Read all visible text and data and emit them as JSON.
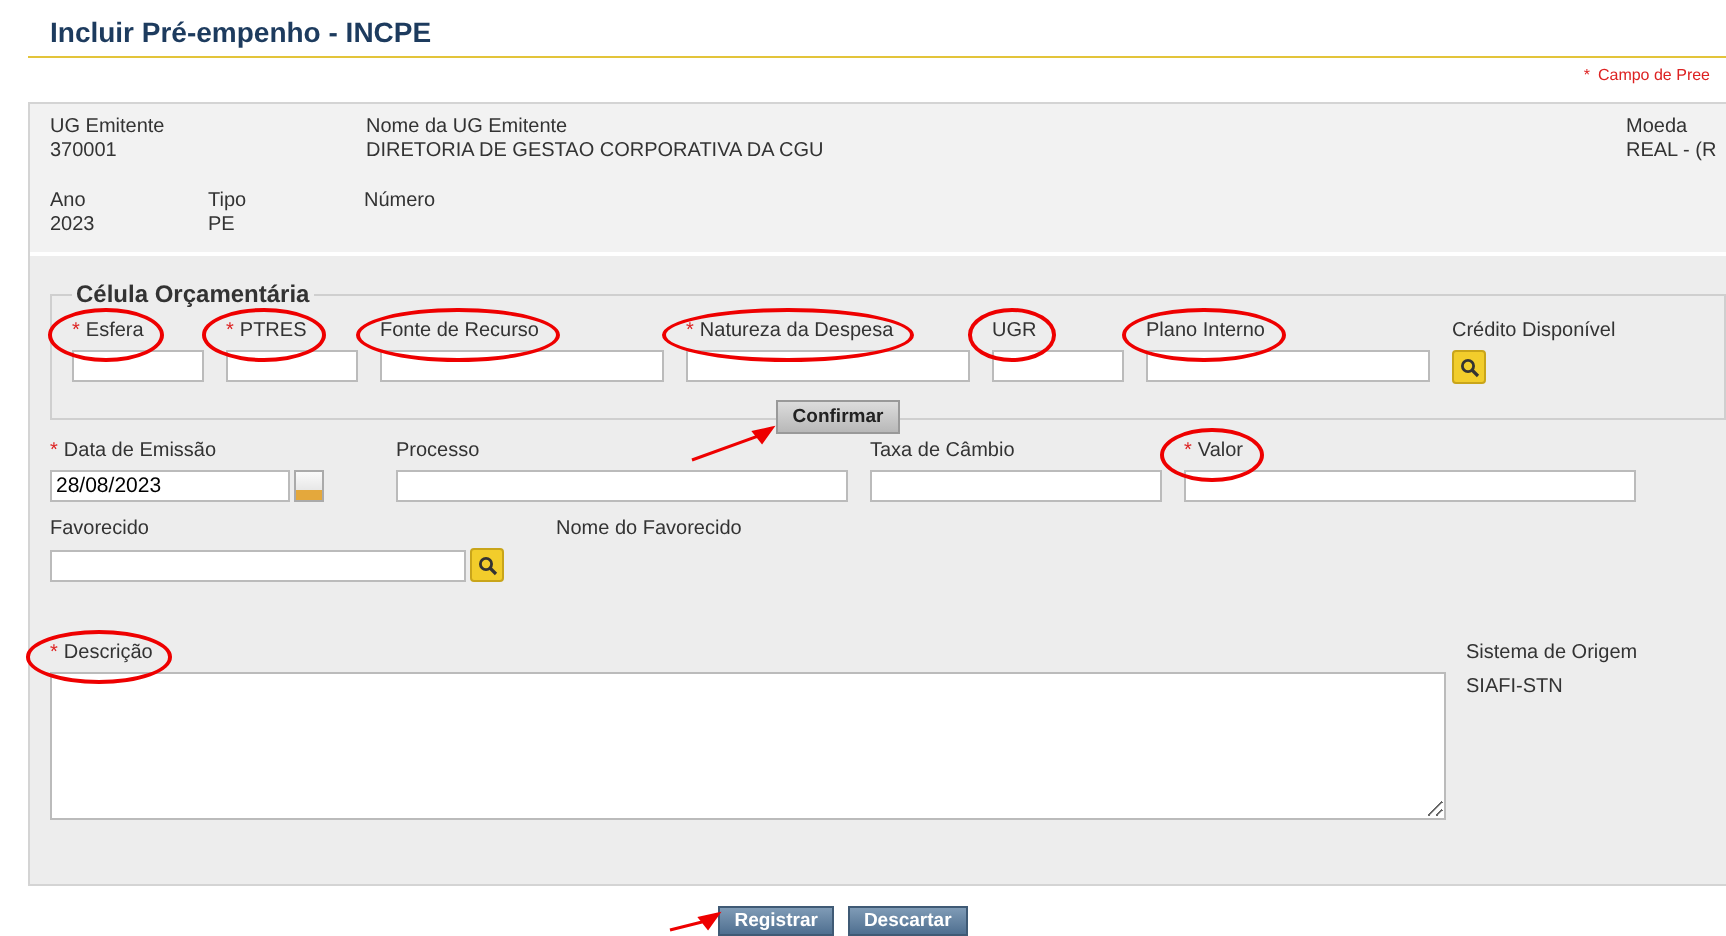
{
  "title": "Incluir Pré-empenho - INCPE",
  "required_note": {
    "mark": "*",
    "text": "Campo de Pree"
  },
  "header": {
    "row1": [
      {
        "label": "UG Emitente",
        "value": "370001"
      },
      {
        "label": "Nome da UG Emitente",
        "value": "DIRETORIA DE GESTAO CORPORATIVA DA CGU"
      },
      {
        "label": "Moeda",
        "value": "REAL - (R"
      }
    ],
    "row2": [
      {
        "label": "Ano",
        "value": "2023"
      },
      {
        "label": "Tipo",
        "value": "PE"
      },
      {
        "label": "Número"
      }
    ]
  },
  "celula": {
    "legend": "Célula Orçamentária",
    "fields": [
      {
        "label": "Esfera",
        "required": true,
        "circled": true
      },
      {
        "label": "PTRES",
        "required": true,
        "circled": true
      },
      {
        "label": "Fonte de Recurso",
        "required": false,
        "circled": true
      },
      {
        "label": "Natureza da Despesa",
        "required": true,
        "circled": true
      },
      {
        "label": "UGR",
        "required": false,
        "circled": true
      },
      {
        "label": "Plano Interno",
        "required": false,
        "circled": true
      }
    ],
    "credit_label": "Crédito Disponível",
    "confirm": {
      "label": "Confirmar",
      "arrow": true
    }
  },
  "row_fields": [
    {
      "label": "Data de Emissão",
      "required": true,
      "circled": false,
      "value": "28/08/2023",
      "kind": "date"
    },
    {
      "label": "Processo",
      "required": false,
      "circled": false,
      "kind": "text"
    },
    {
      "label": "Taxa de Câmbio",
      "required": false,
      "circled": false,
      "kind": "text"
    },
    {
      "label": "Valor",
      "required": true,
      "circled": true,
      "kind": "text"
    }
  ],
  "favorecido": {
    "label": "Favorecido",
    "name_label": "Nome do Favorecido"
  },
  "descricao": {
    "label": "Descrição",
    "required": true,
    "circled": true
  },
  "origem": {
    "label": "Sistema de Origem",
    "value": "SIAFI-STN"
  },
  "buttons": [
    {
      "label": "Registrar",
      "arrow": true
    },
    {
      "label": "Descartar",
      "arrow": false
    }
  ]
}
